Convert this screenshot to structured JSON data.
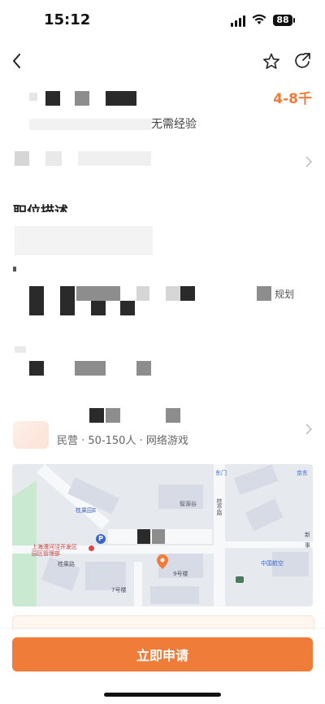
{
  "status_bar": {
    "time": "15:12",
    "battery": "88"
  },
  "job": {
    "salary": "4-8千",
    "experience": "无需经验",
    "description_title": "职位描述",
    "description_fragment": "规划"
  },
  "company": {
    "meta": "民营 · 50-150人 · 网络游戏"
  },
  "map": {
    "labels": [
      "东门",
      "桂亭路",
      "京东",
      "桂果园E",
      "智源谷",
      "上海漕河泾开发区园区管理部",
      "桂果路",
      "9号楼",
      "中国航空",
      "7号楼",
      "新",
      "事"
    ]
  },
  "footer": {
    "apply_label": "立即申请"
  },
  "colors": {
    "accent": "#f07c3a"
  }
}
